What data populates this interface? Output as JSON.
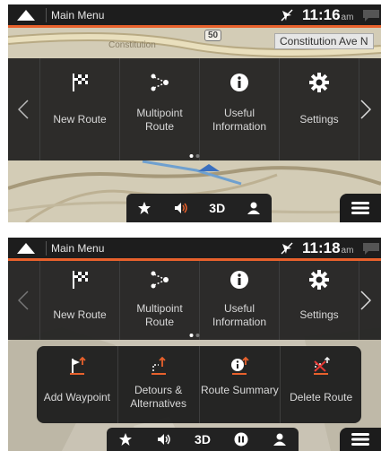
{
  "screen1": {
    "statusbar": {
      "title": "Main Menu",
      "time": "11:16",
      "ampm": "am"
    },
    "map": {
      "street_name": "Constitution Ave N",
      "road_label": "Constitution",
      "route_shield": "50"
    },
    "menu": {
      "items": [
        {
          "label": "New Route",
          "icon": "checkered-flag-icon"
        },
        {
          "label": "Multipoint Route",
          "icon": "multipoint-icon"
        },
        {
          "label": "Useful Information",
          "icon": "info-icon"
        },
        {
          "label": "Settings",
          "icon": "gear-icon"
        }
      ],
      "page": 1,
      "pages": 2
    },
    "bottombar": {
      "view_label": "3D"
    }
  },
  "screen2": {
    "statusbar": {
      "title": "Main Menu",
      "time": "11:18",
      "ampm": "am"
    },
    "menu": {
      "items": [
        {
          "label": "New Route",
          "icon": "checkered-flag-icon"
        },
        {
          "label": "Multipoint Route",
          "icon": "multipoint-icon"
        },
        {
          "label": "Useful Information",
          "icon": "info-icon"
        },
        {
          "label": "Settings",
          "icon": "gear-icon"
        }
      ],
      "page": 1,
      "pages": 2
    },
    "submenu": {
      "items": [
        {
          "label": "Add Waypoint",
          "icon": "add-waypoint-icon"
        },
        {
          "label": "Detours & Alternatives",
          "icon": "detour-icon"
        },
        {
          "label": "Route Summary",
          "icon": "route-summary-icon"
        },
        {
          "label": "Delete Route",
          "icon": "delete-route-icon"
        }
      ]
    },
    "bottombar": {
      "view_label": "3D"
    }
  },
  "colors": {
    "accent": "#e8612c",
    "bar": "#1d1d1d",
    "panel": "#1e1e1e"
  }
}
